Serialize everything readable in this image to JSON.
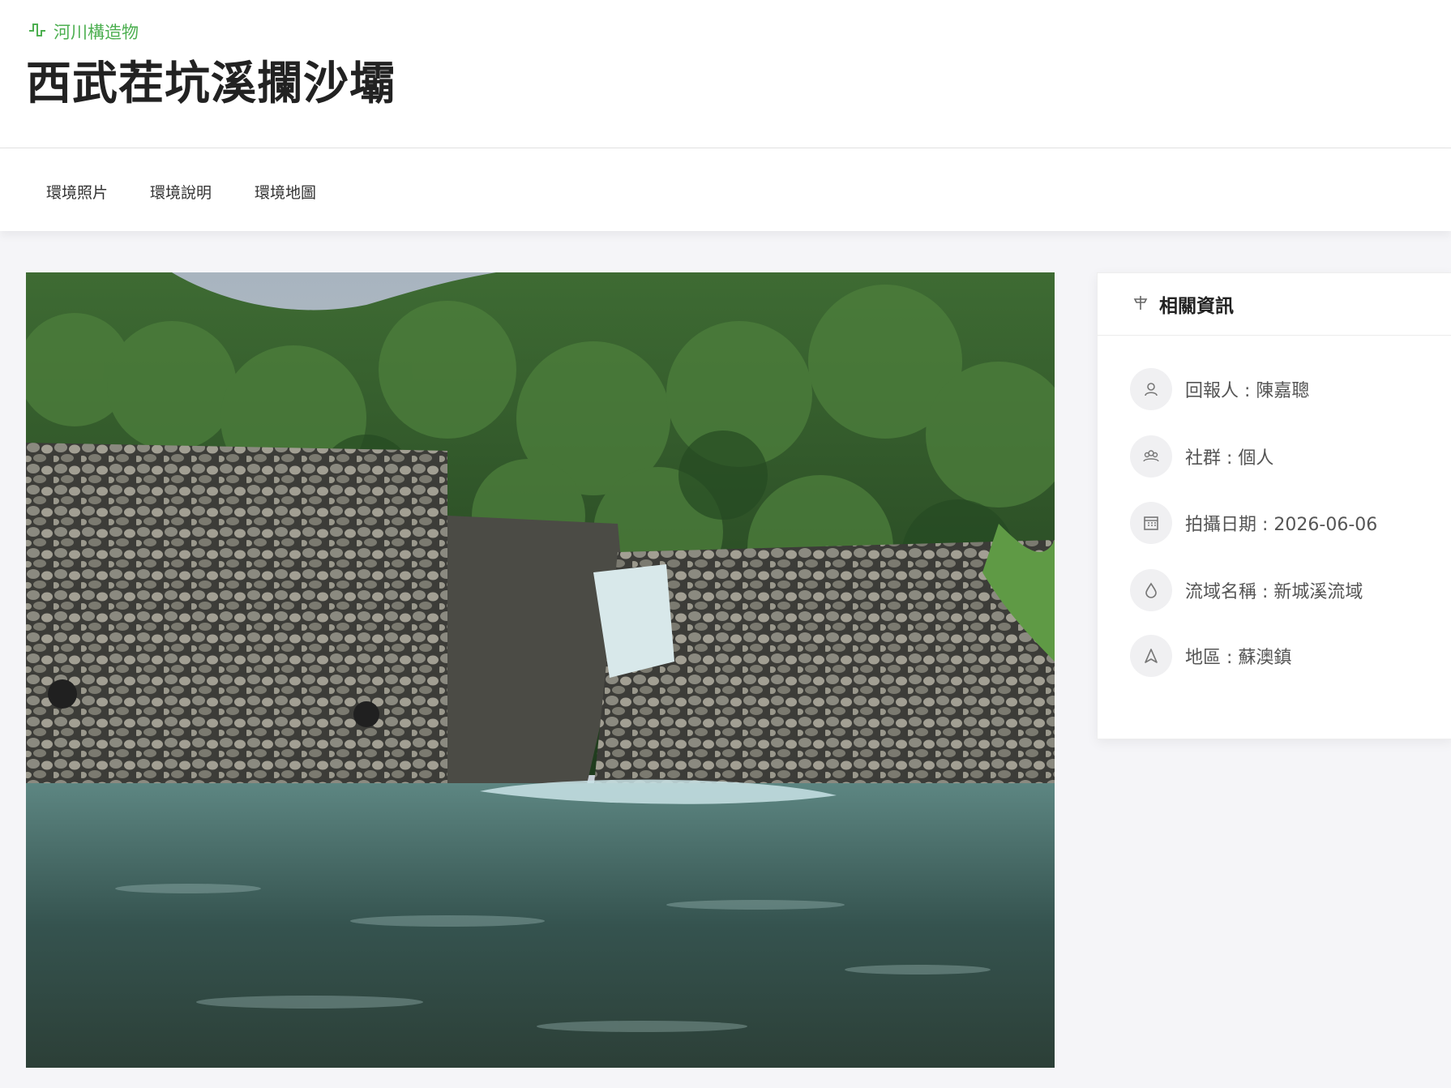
{
  "header": {
    "category_label": "河川構造物",
    "title": "西武茬坑溪攔沙壩"
  },
  "tabs": [
    {
      "label": "環境照片"
    },
    {
      "label": "環境說明"
    },
    {
      "label": "環境地圖"
    }
  ],
  "info": {
    "title": "相關資訊",
    "rows": [
      {
        "label": "回報人",
        "value": "陳嘉聰",
        "icon": "user-icon"
      },
      {
        "label": "社群",
        "value": "個人",
        "icon": "group-icon"
      },
      {
        "label": "拍攝日期",
        "value": "2026-06-06",
        "icon": "calendar-icon"
      },
      {
        "label": "流域名稱",
        "value": "新城溪流域",
        "icon": "water-drop-icon"
      },
      {
        "label": "地區",
        "value": "蘇澳鎮",
        "icon": "navigation-icon"
      }
    ]
  },
  "colors": {
    "accent_green": "#4caf50",
    "background": "#f5f5f8"
  }
}
